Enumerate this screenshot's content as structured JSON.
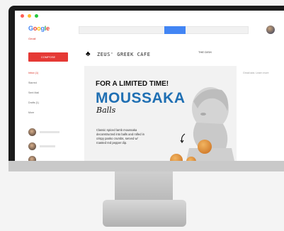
{
  "window": {
    "dot_colors": [
      "#ff5f56",
      "#ffbd2e",
      "#27c93f"
    ]
  },
  "header": {
    "logo_letters": [
      "G",
      "o",
      "o",
      "g",
      "l",
      "e"
    ],
    "logo_colors": [
      "#4285f4",
      "#ea4335",
      "#fbbc05",
      "#4285f4",
      "#34a853",
      "#ea4335"
    ]
  },
  "mail": {
    "app_label": "Gmail",
    "compose_label": "COMPOSE",
    "nav": [
      "Inbox (1)",
      "Starred",
      "Sent Mail",
      "Drafts (1)",
      "More"
    ]
  },
  "email": {
    "header_title": "ZEUS' GREEK CAFE",
    "header_right": "THE DISH",
    "sidebar_note": "Gmail ads: Learn more",
    "banner": {
      "line1": "FOR A LIMITED TIME!",
      "line2": "MOUSSAKA",
      "line3": "Balls",
      "description": "Classic spiced lamb moussaka deconstructed into balls and rolled in crispy panko crumbs, served w/ roasted red pepper dip."
    }
  },
  "colors": {
    "accent_red": "#e53935",
    "accent_blue": "#4285f4",
    "banner_blue": "#1f6fb3"
  }
}
